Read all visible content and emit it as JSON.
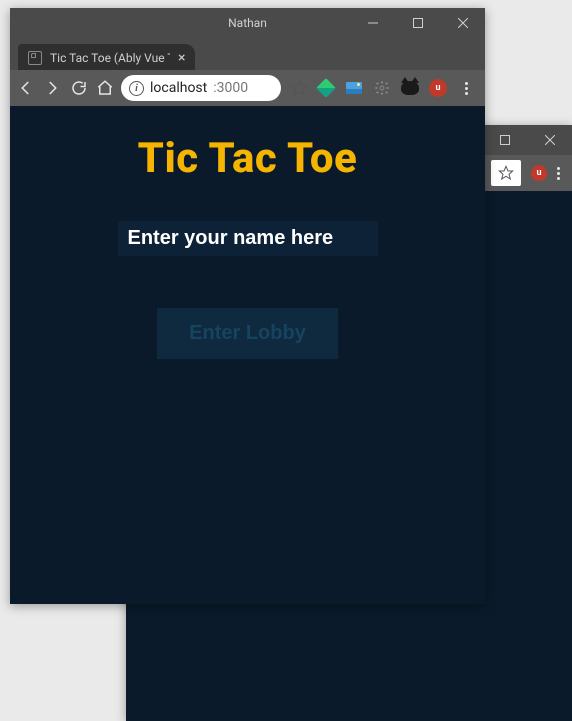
{
  "windows": {
    "front": {
      "profile_name": "Nathan",
      "tab": {
        "title": "Tic Tac Toe (Ably Vue Tut"
      },
      "url": {
        "host": "localhost",
        "port": ":3000"
      }
    }
  },
  "app": {
    "title": "Tic Tac Toe",
    "name_input": {
      "placeholder": "Enter your name here",
      "value": ""
    },
    "enter_button": "Enter Lobby"
  }
}
